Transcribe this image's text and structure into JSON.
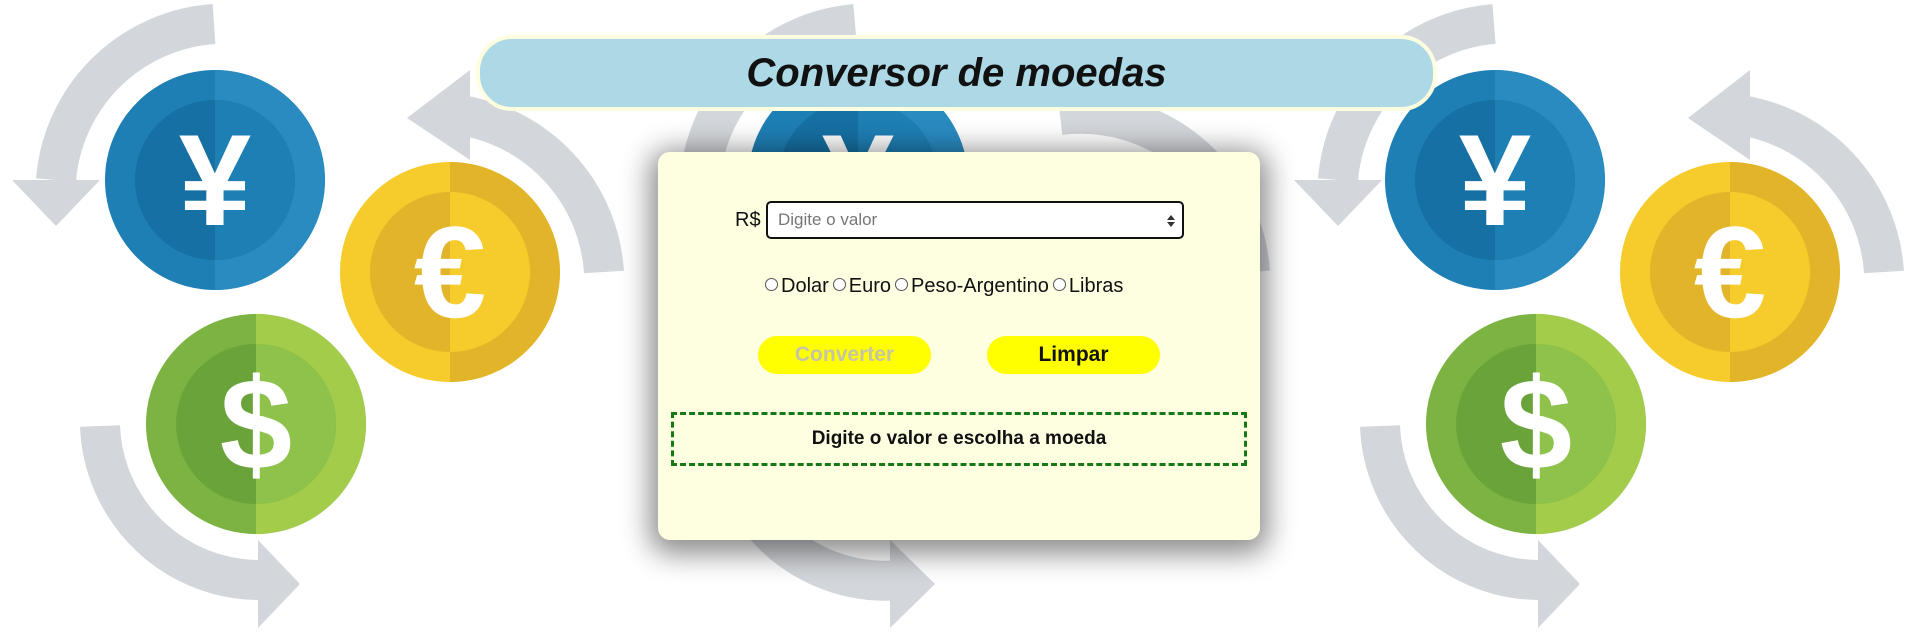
{
  "header": {
    "title": "Conversor de moedas"
  },
  "form": {
    "currency_label": "R$",
    "value_input": {
      "placeholder": "Digite o valor",
      "value": ""
    },
    "currency_options": [
      "Dolar",
      "Euro",
      "Peso-Argentino",
      "Libras"
    ],
    "convert_label": "Converter",
    "clear_label": "Limpar",
    "message": "Digite o valor e escolha a moeda"
  },
  "background": {
    "coin_symbols": {
      "yen": "¥",
      "euro": "€",
      "dollar": "$"
    },
    "colors": {
      "yen_coin": "#1e7fb4",
      "euro_coin": "#f5cc2c",
      "dollar_coin": "#8fc24a",
      "arrows": "#d3d6da"
    }
  },
  "colors": {
    "title_bar": "#add8e6",
    "panel": "#fefee0",
    "buttons": "#ffff00",
    "message_border": "#157a15"
  }
}
